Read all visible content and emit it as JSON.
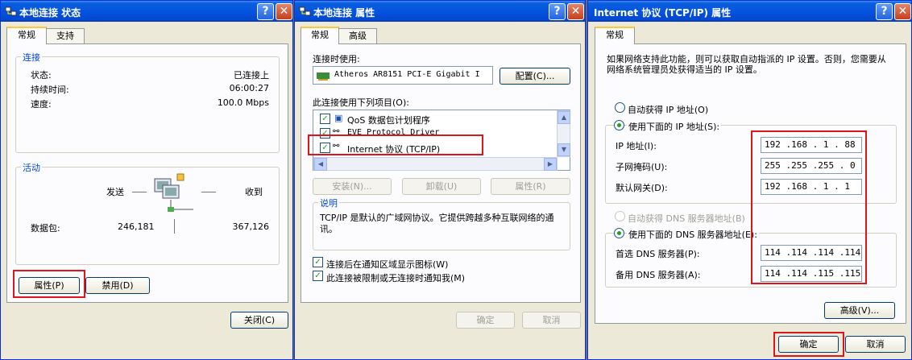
{
  "win1": {
    "title": "本地连接 状态",
    "tabs": [
      "常规",
      "支持"
    ],
    "conn_group": "连接",
    "status_label": "状态:",
    "status_value": "已连接上",
    "duration_label": "持续时间:",
    "duration_value": "06:00:27",
    "speed_label": "速度:",
    "speed_value": "100.0 Mbps",
    "activity_group": "活动",
    "sent_label": "发送",
    "recv_label": "收到",
    "packets_label": "数据包:",
    "packets_sent": "246,181",
    "packets_recv": "367,126",
    "properties_btn": "属性(P)",
    "disable_btn": "禁用(D)",
    "close_btn": "关闭(C)"
  },
  "win2": {
    "title": "本地连接 属性",
    "tabs": [
      "常规",
      "高级"
    ],
    "connect_using_label": "连接时使用:",
    "adapter": "Atheros AR8151 PCI-E Gigabit I",
    "configure_btn": "配置(C)...",
    "items_label": "此连接使用下列项目(O):",
    "items": [
      "QoS 数据包计划程序",
      "EVE Protocol Driver",
      "Internet 协议 (TCP/IP)"
    ],
    "install_btn": "安装(N)...",
    "uninstall_btn": "卸载(U)",
    "props_btn": "属性(R)",
    "desc_group": "说明",
    "desc_text": "TCP/IP 是默认的广域网协议。它提供跨越多种互联网络的通讯。",
    "show_icon_check": "连接后在通知区域显示图标(W)",
    "notify_check": "此连接被限制或无连接时通知我(M)",
    "ok_btn": "确定",
    "cancel_btn": "取消"
  },
  "win3": {
    "title": "Internet 协议 (TCP/IP) 属性",
    "tab": "常规",
    "intro": "如果网络支持此功能，则可以获取自动指派的 IP 设置。否则，您需要从网络系统管理员处获得适当的 IP 设置。",
    "auto_ip": "自动获得 IP 地址(O)",
    "use_ip": "使用下面的 IP 地址(S):",
    "ip_label": "IP 地址(I):",
    "ip_value": "192 .168 . 1  . 88",
    "mask_label": "子网掩码(U):",
    "mask_value": "255 .255 .255 . 0",
    "gw_label": "默认网关(D):",
    "gw_value": "192 .168 . 1  . 1",
    "auto_dns": "自动获得 DNS 服务器地址(B)",
    "use_dns": "使用下面的 DNS 服务器地址(E):",
    "dns1_label": "首选 DNS 服务器(P):",
    "dns1_value": "114 .114 .114 .114",
    "dns2_label": "备用 DNS 服务器(A):",
    "dns2_value": "114 .114 .115 .115",
    "advanced_btn": "高级(V)...",
    "ok_btn": "确定",
    "cancel_btn": "取消"
  },
  "icons": [
    "network-icon",
    "help-icon",
    "close-icon",
    "network-adapter-icon",
    "computers-activity-icon"
  ],
  "colors": {
    "titlebar": "#0454e0",
    "highlight_box": "#e0141c",
    "window_bg": "#ece9d8"
  }
}
